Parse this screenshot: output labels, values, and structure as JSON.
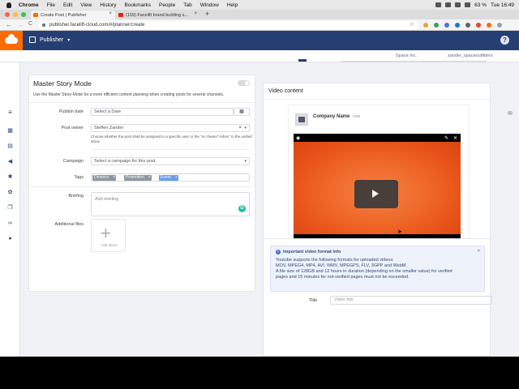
{
  "menubar": {
    "app": "Chrome",
    "items": [
      "File",
      "Edit",
      "View",
      "History",
      "Bookmarks",
      "People",
      "Tab",
      "Window",
      "Help"
    ],
    "battery": "63 %",
    "clock": "Tue 16:49"
  },
  "browser": {
    "tabs": [
      {
        "title": "Create Post | Publisher",
        "close": "×"
      },
      {
        "title": "(109) Facelift brand building s...",
        "close": "×"
      }
    ],
    "new_tab": "+",
    "url": "publisher.facelift-cloud.com/#/planner/create",
    "back": "←",
    "forward": "→",
    "reload": "C",
    "bookmark_icon": "☆"
  },
  "header": {
    "product": "Publisher",
    "caret": "▾",
    "help": "?",
    "account_space": "Space Inc.",
    "account_user": "zander_spaceoutfitters"
  },
  "form": {
    "title": "Master Story Mode",
    "description": "Use the Master Story-Mode for a more efficient content planning when creating posts for several channels.",
    "publish_date_label": "Publish date",
    "publish_date_placeholder": "Select a Date",
    "post_owner_label": "Post owner",
    "post_owner_value": "Steffen Zander",
    "post_owner_hint": "Choose whether the post shall be assigned to a specific user or the \"no Owner\"-Inbox\" in the unified inbox.",
    "campaign_label": "Campaign",
    "campaign_placeholder": "Select a campaign for this post.",
    "tags_label": "Tags",
    "tags": [
      "Dmexco",
      "Promotion",
      "Event"
    ],
    "tag_remove": "×",
    "briefing_label": "Briefing",
    "briefing_placeholder": "Add briefing",
    "additional_files_label": "Additional files",
    "add_items": "Add items",
    "plus": "+"
  },
  "preview": {
    "section_title": "Video content",
    "company_name": "Company Name",
    "time": "· now"
  },
  "info": {
    "title": "Important video format info",
    "line1": "Youtube supports the following formats for uploaded videos:",
    "line2": "MOV, MPEG4, MP4, AVI, WMV, MPEGPS, FLV, 3GPP and WebM.",
    "line3": "A file size of 128GB and 12 hours in duration (depending on the smaller value) for verified",
    "line4": "pages and 15 minutes for not-verified pages must not be exceeded.",
    "close": "×",
    "icon": "i"
  },
  "title_field": {
    "label": "Title",
    "placeholder": "Video title"
  },
  "colors": {
    "header_bg": "#263f73",
    "brand_orange": "#ff6b00",
    "tag_grey": "#8d96a1",
    "tag_blue": "#6c9be8"
  }
}
